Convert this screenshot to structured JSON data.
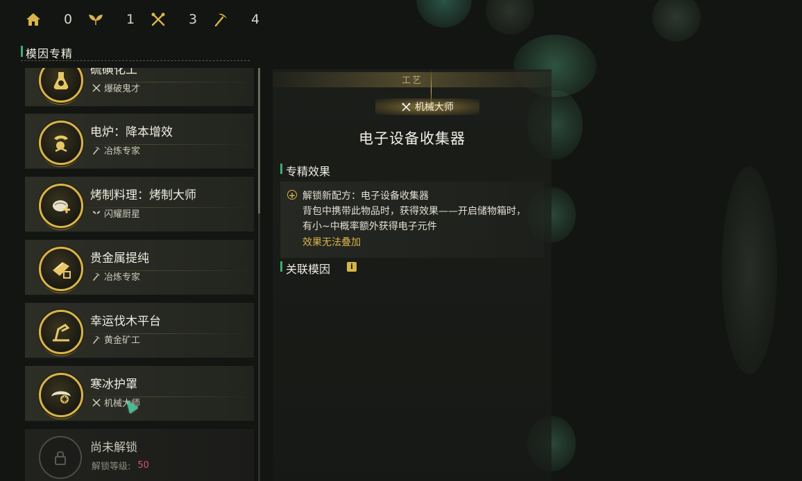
{
  "resources": [
    {
      "icon": "home-icon",
      "count": "0"
    },
    {
      "icon": "leaf-icon",
      "count": "1"
    },
    {
      "icon": "crossed-tools-icon",
      "count": "3"
    },
    {
      "icon": "pickaxe-icon",
      "count": "4"
    }
  ],
  "section_title": "模因专精",
  "cards": [
    {
      "title": "硫磺化工",
      "sub_icon": "crossed-tools-icon",
      "subtitle": "爆破鬼才"
    },
    {
      "title": "电炉：降本增效",
      "sub_icon": "pickaxe-icon",
      "subtitle": "冶炼专家"
    },
    {
      "title": "烤制料理：烤制大师",
      "sub_icon": "leaf-icon",
      "subtitle": "闪耀厨星"
    },
    {
      "title": "贵金属提纯",
      "sub_icon": "pickaxe-icon",
      "subtitle": "冶炼专家"
    },
    {
      "title": "幸运伐木平台",
      "sub_icon": "pickaxe-icon",
      "subtitle": "黄金矿工"
    },
    {
      "title": "寒冰护罩",
      "sub_icon": "crossed-tools-icon",
      "subtitle": "机械大师"
    }
  ],
  "locked_card": {
    "title": "尚未解锁",
    "level_label": "解锁等级:",
    "level_value": "50"
  },
  "detail": {
    "category": "工艺",
    "badge": "机械大师",
    "title": "电子设备收集器",
    "effect_header": "专精效果",
    "effect_lines": [
      "解锁新配方：电子设备收集器",
      "背包中携带此物品时，获得效果——开启储物箱时，",
      "有小~中概率额外获得电子元件"
    ],
    "effect_note": "效果无法叠加",
    "related_header": "关联模因"
  },
  "colors": {
    "accent_green": "#3fae72",
    "gold": "#d9b44a",
    "level_red": "#d9536a"
  }
}
